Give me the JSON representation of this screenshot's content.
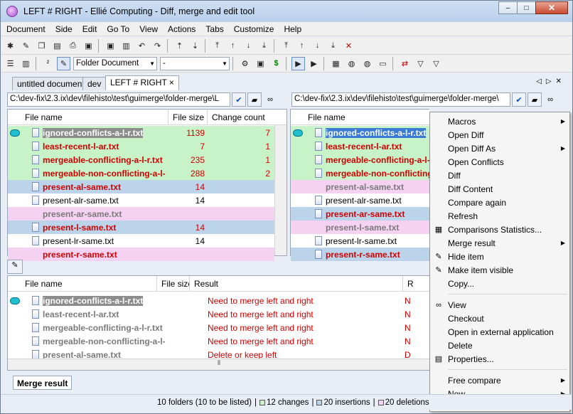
{
  "window": {
    "title": "LEFT # RIGHT - Ellié Computing - Diff, merge and edit tool",
    "min": "–",
    "max": "□",
    "close": "✕"
  },
  "menu": [
    "Document",
    "Side",
    "Edit",
    "Go To",
    "View",
    "Actions",
    "Tabs",
    "Customize",
    "Help"
  ],
  "toolbar2": {
    "document_type": "Folder Document",
    "second_combo": "-"
  },
  "tabs": [
    {
      "label": "untitled document"
    },
    {
      "label": "dev"
    },
    {
      "label": "LEFT # RIGHT",
      "close": "×"
    }
  ],
  "left": {
    "path": "C:\\dev-fix\\2.3.ix\\dev\\filehisto\\test\\guimerge\\folder-merge\\L",
    "headers": [
      "File name",
      "File size",
      "Change count"
    ],
    "rows": [
      {
        "name": "ignored-conflicts-a-l-r.txt",
        "size": "1139",
        "count": "7",
        "bg": "g",
        "style": "gry",
        "sel": true,
        "oval": true
      },
      {
        "name": "least-recent-l-ar.txt",
        "size": "7",
        "count": "1",
        "bg": "g",
        "style": "red"
      },
      {
        "name": "mergeable-conflicting-a-l-r.txt",
        "size": "235",
        "count": "1",
        "bg": "g",
        "style": "red"
      },
      {
        "name": "mergeable-non-conflicting-a-l-",
        "size": "288",
        "count": "2",
        "bg": "g",
        "style": "red"
      },
      {
        "name": "present-al-same.txt",
        "size": "14",
        "count": "",
        "bg": "b",
        "style": "red"
      },
      {
        "name": "present-alr-same.txt",
        "size": "14",
        "count": "",
        "bg": "w",
        "style": "blk"
      },
      {
        "name": "present-ar-same.txt",
        "size": "",
        "count": "",
        "bg": "p",
        "style": "gry",
        "noicon": true
      },
      {
        "name": "present-l-same.txt",
        "size": "14",
        "count": "",
        "bg": "b",
        "style": "red"
      },
      {
        "name": "present-lr-same.txt",
        "size": "14",
        "count": "",
        "bg": "w",
        "style": "blk"
      },
      {
        "name": "present-r-same.txt",
        "size": "",
        "count": "",
        "bg": "p",
        "style": "red",
        "noicon": true
      }
    ]
  },
  "right": {
    "path": "C:\\dev-fix\\2.3.ix\\dev\\filehisto\\test\\guimerge\\folder-merge\\",
    "headers": [
      "File name"
    ],
    "rows": [
      {
        "name": "ignored-conflicts-a-l-r.txt",
        "bg": "g",
        "style": "gry",
        "sel": true,
        "oval": true
      },
      {
        "name": "least-recent-l-ar.txt",
        "bg": "g",
        "style": "red"
      },
      {
        "name": "mergeable-conflicting-a-l-r.txt",
        "bg": "g",
        "style": "red"
      },
      {
        "name": "mergeable-non-conflicting-a-l",
        "bg": "g",
        "style": "red"
      },
      {
        "name": "present-al-same.txt",
        "bg": "p",
        "style": "gry",
        "noicon": true
      },
      {
        "name": "present-alr-same.txt",
        "bg": "w",
        "style": "blk"
      },
      {
        "name": "present-ar-same.txt",
        "bg": "b",
        "style": "red"
      },
      {
        "name": "present-l-same.txt",
        "bg": "p",
        "style": "gry",
        "noicon": true
      },
      {
        "name": "present-lr-same.txt",
        "bg": "w",
        "style": "blk"
      },
      {
        "name": "present-r-same.txt",
        "bg": "b",
        "style": "red"
      }
    ]
  },
  "merge": {
    "headers": [
      "File name",
      "File size",
      "Result",
      "R"
    ],
    "rows": [
      {
        "name": "ignored-conflicts-a-l-r.txt",
        "result": "Need to merge left and right",
        "r": "N",
        "style": "gry",
        "sel": true,
        "oval": true
      },
      {
        "name": "least-recent-l-ar.txt",
        "result": "Need to merge left and right",
        "r": "N",
        "style": "gry"
      },
      {
        "name": "mergeable-conflicting-a-l-r.txt",
        "result": "Need to merge left and right",
        "r": "N",
        "style": "gry"
      },
      {
        "name": "mergeable-non-conflicting-a-l-",
        "result": "Need to merge left and right",
        "r": "N",
        "style": "gry"
      },
      {
        "name": "present-al-same.txt",
        "result": "Delete or keep left",
        "r": "D",
        "style": "gry"
      }
    ],
    "tab": "Merge result"
  },
  "context_menu": [
    {
      "label": "Macros",
      "sub": true
    },
    {
      "label": "Open Diff"
    },
    {
      "label": "Open Diff As",
      "sub": true
    },
    {
      "label": "Open Conflicts"
    },
    {
      "label": "Diff"
    },
    {
      "label": "Diff Content"
    },
    {
      "label": "Compare again"
    },
    {
      "label": "Refresh"
    },
    {
      "label": "Comparisons Statistics...",
      "icon": "stats-icon"
    },
    {
      "label": "Merge result",
      "sub": true
    },
    {
      "label": "Hide item",
      "icon": "hide-icon"
    },
    {
      "label": "Make item visible",
      "icon": "visible-icon"
    },
    {
      "label": "Copy..."
    },
    {
      "sep": true
    },
    {
      "label": "View",
      "icon": "glasses-icon"
    },
    {
      "label": "Checkout"
    },
    {
      "label": "Open in external application"
    },
    {
      "label": "Delete"
    },
    {
      "label": "Properties...",
      "icon": "properties-icon"
    },
    {
      "sep": true
    },
    {
      "label": "Free compare",
      "sub": true
    },
    {
      "label": "New",
      "sub": true
    }
  ],
  "status": {
    "folders": "10 folders (10 to be listed)",
    "changes": "12 changes",
    "insertions": "20 insertions",
    "deletions": "20 deletions",
    "colors": {
      "changes": "#c8f2c8",
      "insertions": "#bcd4ea",
      "deletions": "#f6d2f2"
    }
  }
}
